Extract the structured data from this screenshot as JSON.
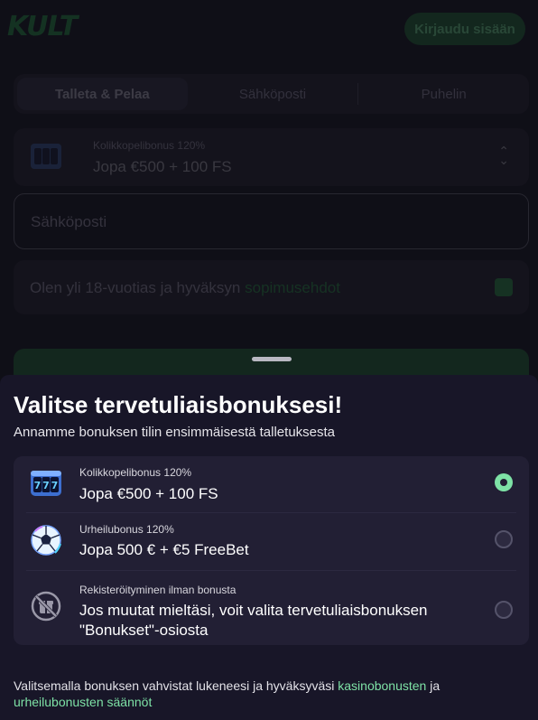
{
  "header": {
    "logo_text": "KULT",
    "login_label": "Kirjaudu sisään"
  },
  "tabs": [
    {
      "label": "Talleta & Pelaa"
    },
    {
      "label": "Sähköposti"
    },
    {
      "label": "Puhelin"
    }
  ],
  "form": {
    "bonus_select": {
      "sub": "Kolikkopelibonus 120%",
      "main": "Jopa €500 + 100 FS"
    },
    "email_placeholder": "Sähköposti",
    "age_text": "Olen yli 18-vuotias ja hyväksyn ",
    "age_link": "sopimusehdot"
  },
  "sheet": {
    "title": "Valitse tervetuliaisbonuksesi!",
    "subtitle": "Annamme bonuksen tilin ensimmäisestä talletuksesta",
    "options": [
      {
        "sub": "Kolikkopelibonus 120%",
        "main": "Jopa €500 + 100 FS",
        "icon": "slot-machine-icon",
        "selected": true
      },
      {
        "sub": "Urheilubonus 120%",
        "main": "Jopa 500 € + €5 FreeBet",
        "icon": "soccer-ball-icon",
        "selected": false
      },
      {
        "sub": "Rekisteröityminen ilman bonusta",
        "main_line1": "Jos muutat mieltäsi, voit valita tervetuliaisbonuksen",
        "main_line2": "\"Bonukset\"-osiosta",
        "icon": "no-bonus-icon",
        "selected": false
      }
    ],
    "footer": {
      "text1": "Valitsemalla bonuksen vahvistat lukeneesi ja hyväksyväsi ",
      "link1": "kasinobonusten",
      "text2": " ja ",
      "link2": "urheilubonusten säännöt"
    }
  },
  "colors": {
    "accent": "#7ee2a6",
    "sheet_bg": "#181628",
    "card_bg": "#221f34"
  }
}
